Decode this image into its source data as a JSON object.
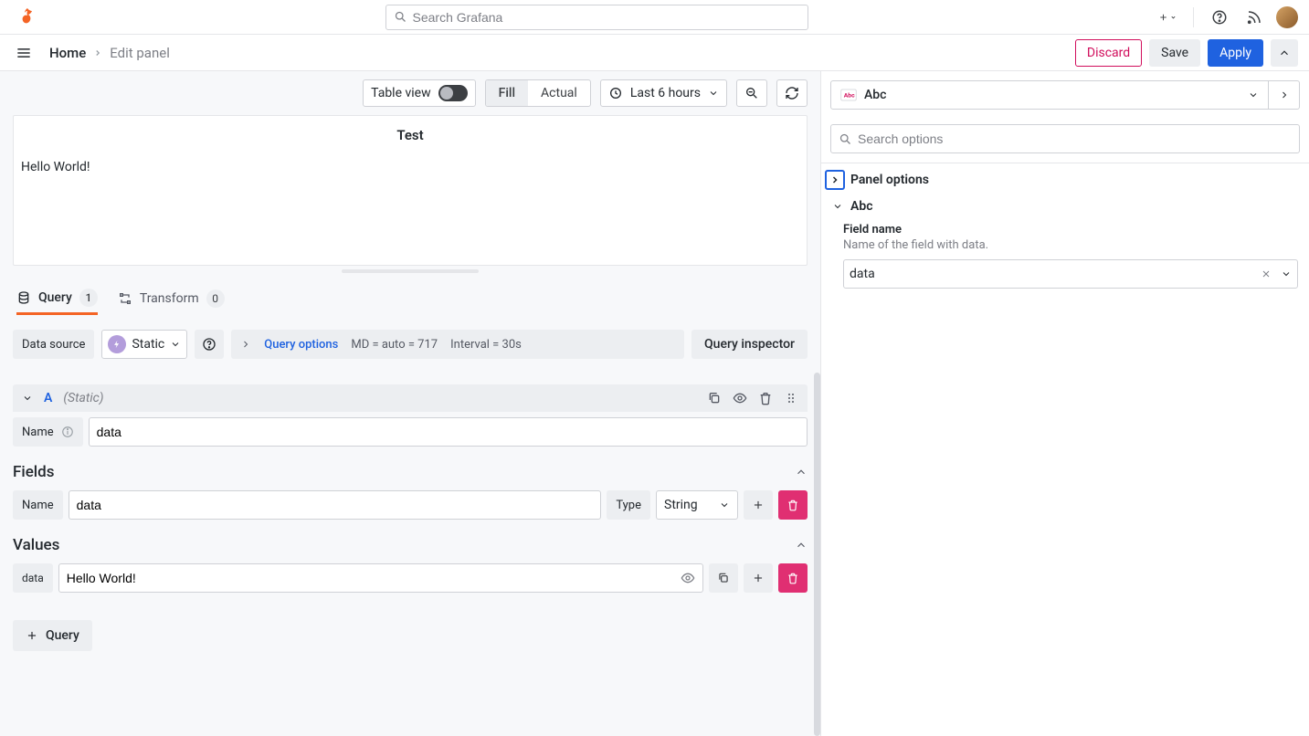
{
  "topbar": {
    "search_placeholder": "Search Grafana"
  },
  "breadcrumb": {
    "home": "Home",
    "current": "Edit panel"
  },
  "actions": {
    "discard": "Discard",
    "save": "Save",
    "apply": "Apply"
  },
  "preview_toolbar": {
    "table_view": "Table view",
    "fill": "Fill",
    "actual": "Actual",
    "time_range": "Last 6 hours"
  },
  "panel": {
    "title": "Test",
    "body": "Hello World!"
  },
  "tabs": {
    "query": {
      "label": "Query",
      "count": "1"
    },
    "transform": {
      "label": "Transform",
      "count": "0"
    }
  },
  "datasource": {
    "label": "Data source",
    "name": "Static"
  },
  "query_options": {
    "link": "Query options",
    "md": "MD = auto = 717",
    "interval": "Interval = 30s",
    "inspector": "Query inspector"
  },
  "query_a": {
    "ref": "A",
    "src": "(Static)",
    "name_label": "Name",
    "name_value": "data",
    "fields_title": "Fields",
    "field_name_label": "Name",
    "field_name_value": "data",
    "type_label": "Type",
    "type_value": "String",
    "values_title": "Values",
    "value_col": "data",
    "value_value": "Hello World!"
  },
  "add_query": "Query",
  "rightpanel": {
    "viz_name": "Abc",
    "options_search_placeholder": "Search options",
    "panel_options": "Panel options",
    "abc_section": "Abc",
    "field_name_label": "Field name",
    "field_name_help": "Name of the field with data.",
    "field_name_value": "data"
  }
}
